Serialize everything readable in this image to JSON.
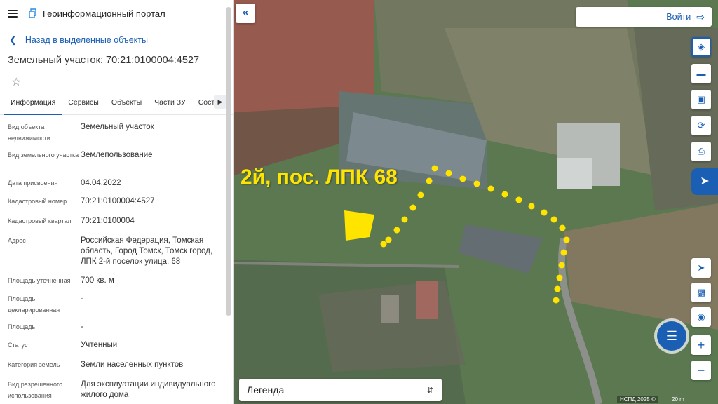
{
  "header": {
    "app_title": "Геоинформационный портал"
  },
  "back_link": "Назад в выделенные объекты",
  "object_title": "Земельный участок: 70:21:0100004:4527",
  "tabs": [
    {
      "label": "Информация",
      "active": true
    },
    {
      "label": "Сервисы"
    },
    {
      "label": "Объекты"
    },
    {
      "label": "Части ЗУ"
    },
    {
      "label": "Состо"
    }
  ],
  "properties": [
    {
      "key": "Вид объекта недвижимости",
      "value": "Земельный участок"
    },
    {
      "key": "Вид земельного участка",
      "value": "Землепользование"
    },
    {
      "key": "Дата присвоения",
      "value": "04.04.2022"
    },
    {
      "key": "Кадастровый номер",
      "value": "70:21:0100004:4527"
    },
    {
      "key": "Кадастровый квартал",
      "value": "70:21:0100004"
    },
    {
      "key": "Адрес",
      "value": "Российская Федерация, Томская область, Город Томск, Томск город, ЛПК 2-й поселок улица, 68"
    },
    {
      "key": "Площадь уточненная",
      "value": "700 кв. м"
    },
    {
      "key": "Площадь декларированная",
      "value": "-"
    },
    {
      "key": "Площадь",
      "value": "-"
    },
    {
      "key": "Статус",
      "value": "Учтенный"
    },
    {
      "key": "Категория земель",
      "value": "Земли населенных пунктов"
    },
    {
      "key": "Вид разрешенного использования",
      "value": "Для эксплуатации индивидуального жилого дома"
    }
  ],
  "map": {
    "login_label": "Войти",
    "legend_label": "Легенда",
    "annotation": "2й, пос. ЛПК 68",
    "attribution": "НСПД 2025 ©",
    "scale": "20 m",
    "accent_color": "#1a5fb4",
    "annotation_color": "#ffe400"
  }
}
